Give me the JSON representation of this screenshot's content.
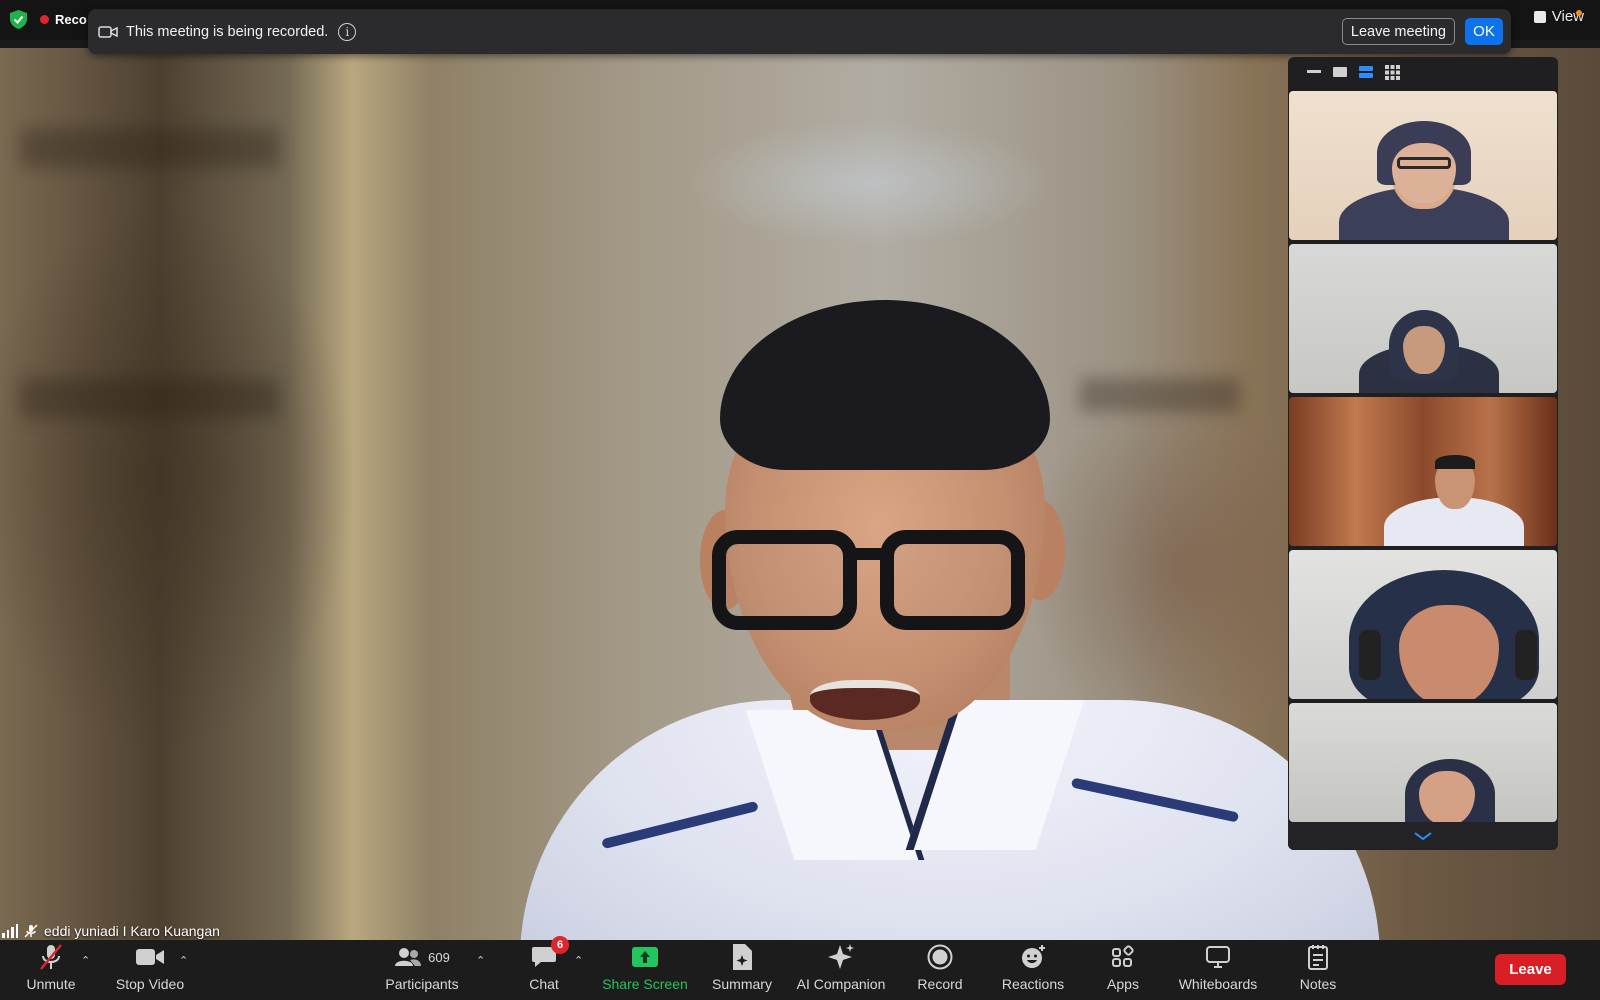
{
  "app": {
    "accent": "#0e72ed",
    "leave_color": "#d91f26",
    "share_color": "#22c55e"
  },
  "top_bar": {
    "recording_label": "Reco",
    "view_label": "View"
  },
  "recording_banner": {
    "message": "This meeting is being recorded.",
    "leave_meeting_label": "Leave meeting",
    "ok_label": "OK"
  },
  "gallery": {
    "layout_options": [
      "hide-self-icon",
      "speaker-icon",
      "strip-icon",
      "grid-icon"
    ],
    "selected_layout": "strip-icon",
    "participants": [
      {
        "icon": "participant-video"
      },
      {
        "icon": "participant-video"
      },
      {
        "icon": "participant-video"
      },
      {
        "icon": "participant-video"
      },
      {
        "icon": "participant-video"
      }
    ],
    "scroll_icon": "chevron-down-icon"
  },
  "speaker": {
    "name": "eddi yuniadi I Karo Kuangan"
  },
  "toolbar": {
    "unmute": "Unmute",
    "stop_video": "Stop Video",
    "participants": "Participants",
    "participants_count": "609",
    "chat": "Chat",
    "chat_badge": "6",
    "share_screen": "Share Screen",
    "summary": "Summary",
    "ai_companion": "AI Companion",
    "record": "Record",
    "reactions": "Reactions",
    "apps": "Apps",
    "whiteboards": "Whiteboards",
    "notes": "Notes",
    "leave": "Leave"
  }
}
